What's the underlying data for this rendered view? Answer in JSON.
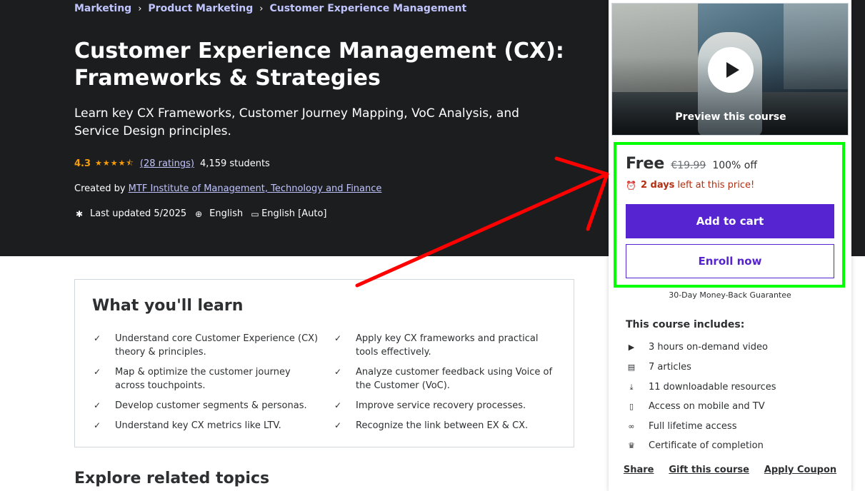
{
  "breadcrumb": [
    "Marketing",
    "Product Marketing",
    "Customer Experience Management"
  ],
  "breadcrumb_separator": "›",
  "course": {
    "title": "Customer Experience Management (CX): Frameworks & Strategies",
    "subtitle": "Learn key CX Frameworks, Customer Journey Mapping, VoC Analysis, and Service Design principles.",
    "rating": "4.3",
    "stars": "★★★★⯪",
    "rating_count": "(28 ratings)",
    "students": "4,159 students",
    "created_by_label": "Created by",
    "instructor": "MTF Institute of Management, Technology and Finance",
    "last_updated": "Last updated 5/2025",
    "language": "English",
    "captions": "English [Auto]"
  },
  "learn": {
    "title": "What you'll learn",
    "check_glyph": "✓",
    "items": [
      "Understand core Customer Experience (CX) theory & principles.",
      "Apply key CX frameworks and practical tools effectively.",
      "Map & optimize the customer journey across touchpoints.",
      "Analyze customer feedback using Voice of the Customer (VoC).",
      "Develop customer segments & personas.",
      "Improve service recovery processes.",
      "Understand key CX metrics like LTV.",
      "Recognize the link between EX & CX."
    ]
  },
  "explore_title": "Explore related topics",
  "sidebar": {
    "preview_label": "Preview this course",
    "price": "Free",
    "original_price": "€19.99",
    "discount": "100% off",
    "timer_bold": "2 days",
    "timer_rest": "left at this price!",
    "add_to_cart": "Add to cart",
    "enroll_now": "Enroll now",
    "guarantee": "30-Day Money-Back Guarantee",
    "includes_title": "This course includes:",
    "includes": [
      {
        "icon": "video-icon",
        "glyph": "▶",
        "text": "3 hours on-demand video"
      },
      {
        "icon": "article-icon",
        "glyph": "▤",
        "text": "7 articles"
      },
      {
        "icon": "download-icon",
        "glyph": "⤓",
        "text": "11 downloadable resources"
      },
      {
        "icon": "mobile-icon",
        "glyph": "▯",
        "text": "Access on mobile and TV"
      },
      {
        "icon": "infinity-icon",
        "glyph": "∞",
        "text": "Full lifetime access"
      },
      {
        "icon": "trophy-icon",
        "glyph": "♛",
        "text": "Certificate of completion"
      }
    ],
    "links": [
      "Share",
      "Gift this course",
      "Apply Coupon"
    ]
  },
  "colors": {
    "hero_bg": "#1c1d1f",
    "accent_purple": "#5624d0",
    "breadcrumb_link": "#c0c4fc",
    "star": "#f69c08",
    "timer_red": "#b32d0f",
    "annotation_green": "#00ff00",
    "annotation_red": "#ff0000"
  }
}
